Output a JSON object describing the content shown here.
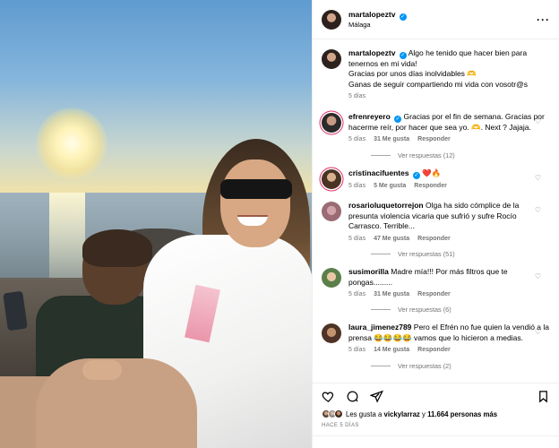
{
  "post": {
    "username": "martalopeztv",
    "location": "Málaga",
    "caption_lines": [
      "Algo he tenido que hacer bien para tenernos en mi vida!",
      "Gracias por unos días inolvidables 🫶",
      "Ganas de seguir compartiendo mi vida con vosotr@s"
    ],
    "caption_time": "5 días",
    "more_icon": "more-dots-icon",
    "verified_icon": "verified-badge-icon"
  },
  "comments": [
    {
      "username": "efrenreyero",
      "verified": "✓",
      "text": "Gracias por el fin de semana. Gracias por hacerme reír, por hacer que sea yo. 🫶. Next ? Jajaja.",
      "time": "5 días",
      "likes": "31 Me gusta",
      "reply": "Responder",
      "view_replies": "Ver respuestas (12)"
    },
    {
      "username": "cristinacifuentes",
      "verified": "✓",
      "text": "❤️🔥",
      "time": "5 días",
      "likes": "5 Me gusta",
      "reply": "Responder"
    },
    {
      "username": "rosarioluquetorrejon",
      "text": "Olga ha sido cómplice de la presunta violencia vicaria que sufrió y sufre Rocío Carrasco. Terrible...",
      "time": "5 días",
      "likes": "47 Me gusta",
      "reply": "Responder",
      "view_replies": "Ver respuestas (51)"
    },
    {
      "username": "susimorilla",
      "text": "Madre mía!!! Por más filtros que te pongas.........",
      "time": "5 días",
      "likes": "31 Me gusta",
      "reply": "Responder",
      "view_replies": "Ver respuestas (6)"
    },
    {
      "username": "laura_jimenez789",
      "text": "Pero el Efrén no fue quien la vendió a la prensa 😂😂😂😂 vamos que lo hicieron a medias.",
      "time": "5 días",
      "likes": "14 Me gusta",
      "reply": "Responder",
      "view_replies": "Ver respuestas (2)"
    }
  ],
  "footer": {
    "likes_prefix": "Les gusta a",
    "likes_user": "vickylarraz",
    "likes_connector": "y",
    "likes_count": "11.664 personas más",
    "timestamp": "HACE 5 DÍAS",
    "icons": [
      "heart-icon",
      "comment-icon",
      "share-icon",
      "save-icon"
    ]
  },
  "colors": {
    "verified": "#0095f6",
    "muted_text": "#737373",
    "story_ring": "#e0306a"
  }
}
